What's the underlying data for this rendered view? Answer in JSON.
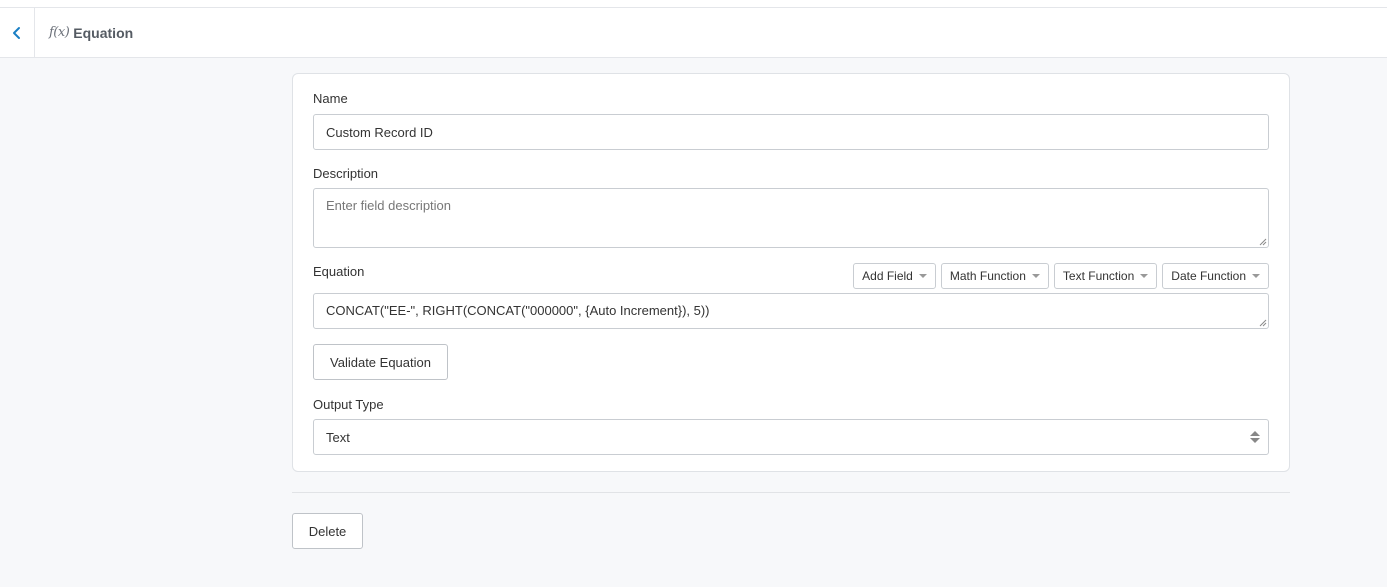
{
  "header": {
    "back_icon": "chevron-left-icon",
    "title_icon": "function-icon",
    "title_icon_text": "f(x)",
    "title": "Equation",
    "accent_color": "#1a7fc4"
  },
  "form": {
    "name": {
      "label": "Name",
      "value": "Custom Record ID"
    },
    "description": {
      "label": "Description",
      "value": "",
      "placeholder": "Enter field description"
    },
    "equation": {
      "label": "Equation",
      "value": "CONCAT(\"EE-\", RIGHT(CONCAT(\"000000\", {Auto Increment}), 5))",
      "function_buttons": [
        {
          "label": "Add Field"
        },
        {
          "label": "Math Function"
        },
        {
          "label": "Text Function"
        },
        {
          "label": "Date Function"
        }
      ]
    },
    "validate_label": "Validate Equation",
    "output_type": {
      "label": "Output Type",
      "selected": "Text"
    }
  },
  "footer": {
    "delete_label": "Delete"
  }
}
